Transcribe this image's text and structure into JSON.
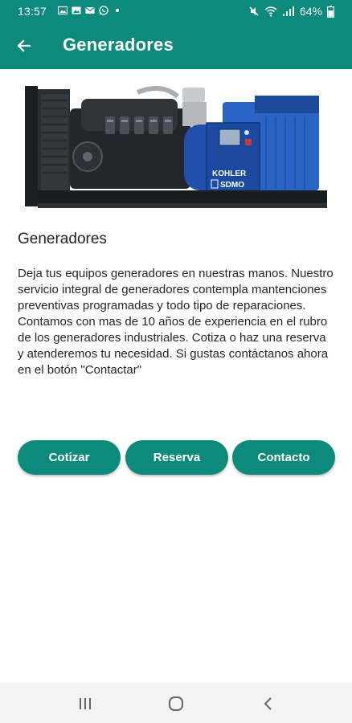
{
  "status_bar": {
    "time": "13:57",
    "battery": "64%",
    "notification_icons": [
      "gallery-icon",
      "gallery-icon",
      "email-icon",
      "whatsapp-icon",
      "dot-icon"
    ],
    "system_icons": [
      "mute-icon",
      "wifi-icon",
      "signal-icon",
      "battery-icon"
    ]
  },
  "app_bar": {
    "title": "Generadores",
    "back_icon": "arrow-back-icon",
    "color": "#0e8a7c"
  },
  "content": {
    "heading": "Generadores",
    "description": "Deja tus equipos generadores en nuestras manos. Nuestro servicio integral de generadores contempla mantenciones preventivas programadas y todo tipo de reparaciones. Contamos con mas de 10 años de experiencia en el rubro de los generadores industriales. Cotiza o haz una reserva y atenderemos tu necesidad. Si gustas contáctanos ahora en el botón \"Contactar\""
  },
  "hero_image": {
    "brand_line1": "KOHLER",
    "brand_line2": "SDMO"
  },
  "actions": {
    "quote_label": "Cotizar",
    "reserve_label": "Reserva",
    "contact_label": "Contacto"
  },
  "nav_bar": {
    "icons": [
      "recent-apps-icon",
      "home-icon",
      "back-icon"
    ]
  }
}
